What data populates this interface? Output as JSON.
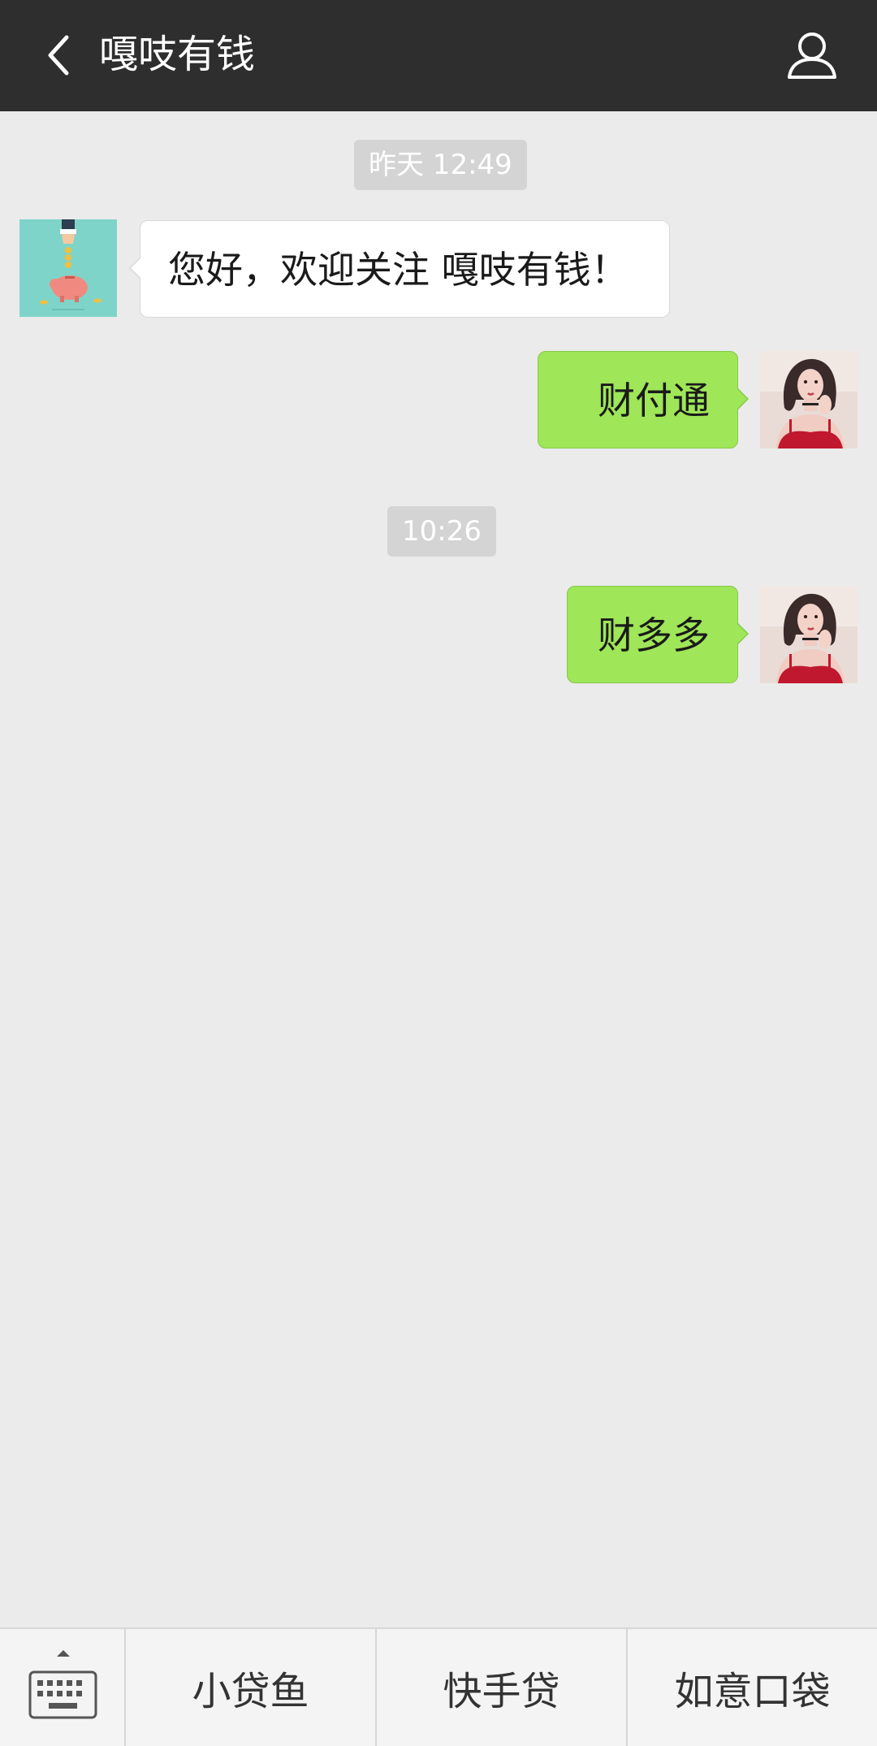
{
  "header": {
    "title": "嘎吱有钱",
    "back_icon": "chevron-left-icon",
    "profile_icon": "person-icon"
  },
  "messages": [
    {
      "type": "time",
      "text": "昨天 12:49"
    },
    {
      "type": "received",
      "text": "您好，欢迎关注 嘎吱有钱！",
      "avatar": "piggy-bank-avatar"
    },
    {
      "type": "sent",
      "text": "财付通",
      "avatar": "user-avatar"
    },
    {
      "type": "time",
      "text": "10:26"
    },
    {
      "type": "sent",
      "text": "财多多",
      "avatar": "user-avatar"
    }
  ],
  "bottom_menu": {
    "keyboard_icon": "keyboard-icon",
    "items": [
      {
        "label": "小贷鱼"
      },
      {
        "label": "快手贷"
      },
      {
        "label": "如意口袋"
      }
    ]
  },
  "colors": {
    "header_bg": "#2e2e2e",
    "chat_bg": "#ebebeb",
    "sent_bubble": "#9fe658",
    "received_bubble": "#ffffff",
    "time_pill": "#d4d4d4"
  }
}
